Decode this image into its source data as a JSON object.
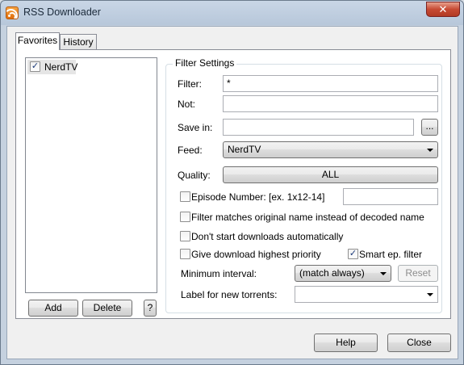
{
  "window": {
    "title": "RSS Downloader",
    "close_glyph": "✕",
    "app_icon": "rss-feed-icon"
  },
  "tabs": [
    {
      "label": "Favorites",
      "selected": true
    },
    {
      "label": "History",
      "selected": false
    }
  ],
  "favorites": {
    "items": [
      {
        "label": "NerdTV",
        "checked": true
      }
    ],
    "add_label": "Add",
    "delete_label": "Delete",
    "help_label": "?"
  },
  "filter_settings": {
    "title": "Filter Settings",
    "filter": {
      "label": "Filter:",
      "value": "*"
    },
    "not": {
      "label": "Not:",
      "value": ""
    },
    "save_in": {
      "label": "Save in:",
      "value": "",
      "browse_label": "..."
    },
    "feed": {
      "label": "Feed:",
      "value": "NerdTV"
    },
    "quality": {
      "label": "Quality:",
      "value": "ALL"
    },
    "episode_number": {
      "label": "Episode Number: [ex. 1x12-14]",
      "checked": false,
      "value": ""
    },
    "match_original": {
      "label": "Filter matches original name instead of decoded name",
      "checked": false
    },
    "dont_start": {
      "label": "Don't start downloads automatically",
      "checked": false
    },
    "highest_priority": {
      "label": "Give download highest priority",
      "checked": false
    },
    "smart_ep": {
      "label": "Smart ep. filter",
      "checked": true
    },
    "minimum_interval": {
      "label": "Minimum interval:",
      "value": "(match always)",
      "reset_label": "Reset"
    },
    "label_for_new": {
      "label": "Label for new torrents:",
      "value": ""
    }
  },
  "footer": {
    "help_label": "Help",
    "close_label": "Close"
  },
  "colors": {
    "title_bar": "#b7c7da",
    "close_button": "#c74a33",
    "panel": "#ffffff",
    "dialog": "#f0f0f0"
  }
}
